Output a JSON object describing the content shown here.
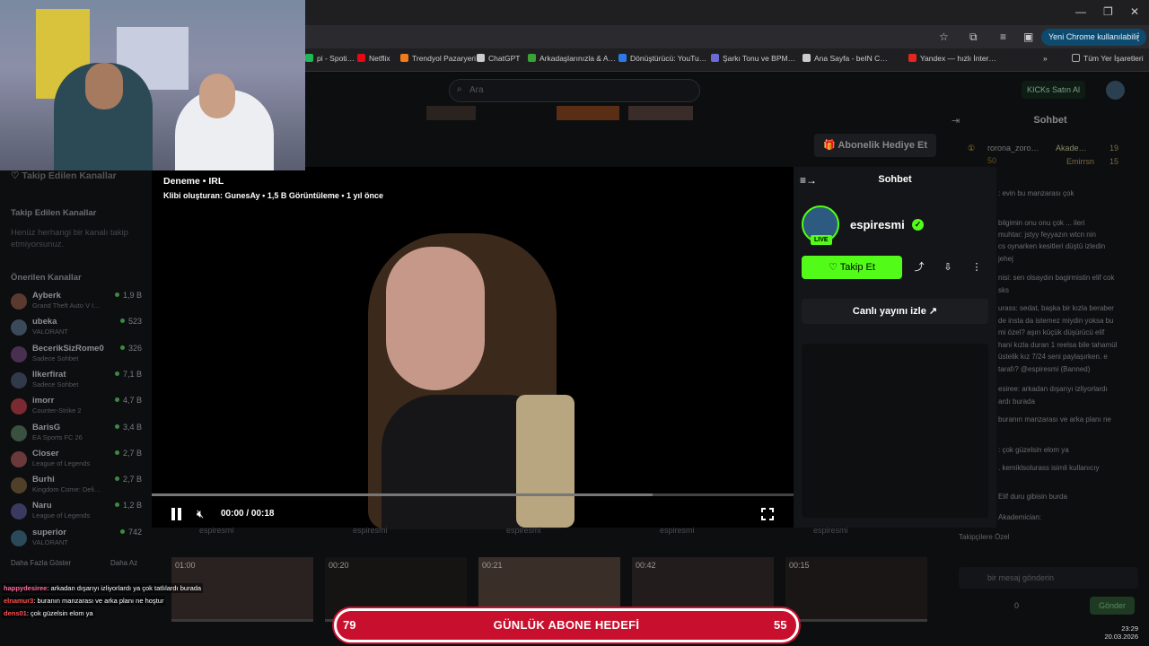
{
  "window": {
    "minimize": "—",
    "restore": "❐",
    "close": "✕"
  },
  "toolbar": {
    "chrome_user": "Yeni Chrome kullanılabilir",
    "menu": "⋮"
  },
  "bookmarks": [
    {
      "label": "pi - Spoti…",
      "color": "#1db954"
    },
    {
      "label": "Netflix",
      "color": "#e50914"
    },
    {
      "label": "Trendyol Pazaryeri",
      "color": "#f27a1a"
    },
    {
      "label": "ChatGPT",
      "color": "#cccccc"
    },
    {
      "label": "Arkadaşlarınızla & A…",
      "color": "#3aa335"
    },
    {
      "label": "Dönüştürücü: YouTu…",
      "color": "#2c7be5"
    },
    {
      "label": "Şarkı Tonu ve BPM…",
      "color": "#6b6bd6"
    },
    {
      "label": "Ana Sayfa - beIN C…",
      "color": "#cccccc"
    },
    {
      "label": "Yandex — hızlı İnter…",
      "color": "#e52620"
    }
  ],
  "bookmarks_more": "»",
  "all_bookmarks": "Tüm Yer İşaretleri",
  "header": {
    "search_placeholder": "Ara",
    "kicks": "KICKs Satın Al",
    "gift_sub": "Abonelik Hediye Et"
  },
  "sidebar": {
    "followed_title": "Takip Edilen Kanallar",
    "followed_header": "Takip Edilen Kanallar",
    "empty": "Henüz herhangi bir kanalı takip etmiyorsunuz.",
    "recommended_header": "Önerilen Kanallar",
    "channels": [
      {
        "name": "Ayberk",
        "game": "Grand Theft Auto V I…",
        "viewers": "1,9 B"
      },
      {
        "name": "ubeka",
        "game": "VALORANT",
        "viewers": "523"
      },
      {
        "name": "BecerikSizRome0",
        "game": "Sadece Sohbet",
        "viewers": "326"
      },
      {
        "name": "Ilkerfirat",
        "game": "Sadece Sohbet",
        "viewers": "7,1 B"
      },
      {
        "name": "imorr",
        "game": "Counter-Strike 2",
        "viewers": "4,7 B"
      },
      {
        "name": "BarisG",
        "game": "EA Sports FC 26",
        "viewers": "3,4 B"
      },
      {
        "name": "Closer",
        "game": "League of Legends",
        "viewers": "2,7 B"
      },
      {
        "name": "Burhi",
        "game": "Kingdom Come: Deli…",
        "viewers": "2,7 B"
      },
      {
        "name": "Naru",
        "game": "League of Legends",
        "viewers": "1,2 B"
      },
      {
        "name": "superior",
        "game": "VALORANT",
        "viewers": "742"
      }
    ],
    "show_more": "Daha Fazla Göster",
    "show_less": "Daha Az"
  },
  "clip": {
    "title": "Deneme • IRL",
    "meta": "Klibi oluşturan: GunesAy • 1,5 B Görüntüleme • 1 yıl önce",
    "time": "00:00 / 00:18",
    "progress": 0.0,
    "buffered": 0.78
  },
  "panel": {
    "title": "Sohbet",
    "streamer": "espiresmi",
    "live": "LIVE",
    "verified": "✓",
    "follow": "♡ Takip Et",
    "watch_live": "Canlı yayını izle ↗"
  },
  "chat": {
    "title": "Sohbet",
    "leaderboard": [
      {
        "name": "rorona_zoro…",
        "pts": "50"
      },
      {
        "name": "Akade…",
        "pts": "19"
      },
      {
        "name": "Emirrsn",
        "pts": "15"
      }
    ],
    "messages": [
      ": evin bu manzarası çok",
      "bilgimin onu onu çok ... ileri",
      "muhtar: jstyy feyyazın wtcn nin",
      "cs oynarken kesitleri düştü izledin",
      "jehej",
      "nisi: sen olsaydın bagirmistin elif cok",
      "sks",
      "urass: sedat, başka bir kızla beraber",
      "de insta da istemez miydin yoksa bu",
      "mi özel? aşırı küçük düşürücü elif",
      "hani kızla duran 1 reelsa bile tahamül",
      "üstelik kız 7/24 seni paylaşırken. e",
      "tarafı? @espiresmi (Banned)",
      "esiree: arkadan dışarıyı izliyorlardı",
      "ardı burada",
      "buranın manzarası ve arka planı ne",
      ": çok güzelsin elom ya",
      ". kemiklsolurass isimli kullanıcıy",
      "Elif duru gibisin burda",
      "Akademician:"
    ],
    "supporters": "Takipçilere Özel",
    "input_placeholder": "bir mesaj gönderin",
    "send": "Gönder",
    "count1": "0",
    "count2": "0"
  },
  "strip": {
    "labels": [
      "espiresmi",
      "espiresmi",
      "espiresmi",
      "espiresmi",
      "espiresmi"
    ],
    "thumbs": [
      "01:00",
      "00:20",
      "00:21",
      "00:42",
      "00:15"
    ]
  },
  "overlay_chat": [
    {
      "name": "happydesiree",
      "text": ": arkadan dışarıyı izliyorlardı ya çok tatlılardı burada"
    },
    {
      "name": "elnamur3",
      "text": ": buranın manzarası ve arka planı ne hoştur"
    },
    {
      "name": "dens01",
      "text": ": çok güzelsin elom ya"
    }
  ],
  "goal": {
    "left": "79",
    "title": "GÜNLÜK ABONE HEDEFİ",
    "right": "55"
  },
  "tray": {
    "time": "23:29",
    "date": "20.03.2026"
  }
}
